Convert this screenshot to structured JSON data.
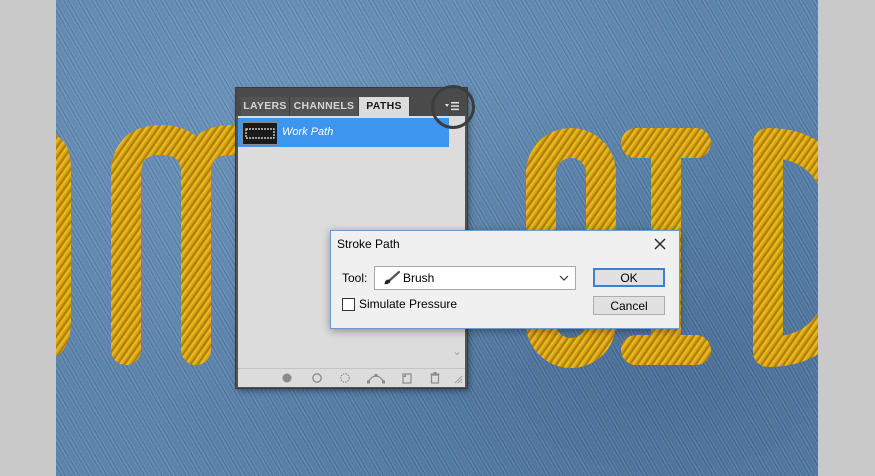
{
  "canvas_text": "CMOOIDI",
  "paths_panel": {
    "tabs": [
      {
        "label": "LAYERS"
      },
      {
        "label": "CHANNELS"
      },
      {
        "label": "PATHS"
      }
    ],
    "active_tab": "PATHS",
    "menu_icon": "panel-menu-icon",
    "paths": [
      {
        "name": "Work Path",
        "selected": true
      }
    ],
    "footer_icons": [
      "fill-path-icon",
      "stroke-path-icon",
      "load-selection-icon",
      "make-work-path-icon",
      "new-path-icon",
      "delete-path-icon"
    ]
  },
  "stroke_dialog": {
    "title": "Stroke Path",
    "tool_label": "Tool:",
    "tool_value": "Brush",
    "simulate_pressure_label": "Simulate Pressure",
    "simulate_pressure_checked": false,
    "ok_label": "OK",
    "cancel_label": "Cancel"
  },
  "colors": {
    "selection": "#3d95f0",
    "denim": "#5b84ad",
    "stitch_gold": "#d9a612"
  }
}
